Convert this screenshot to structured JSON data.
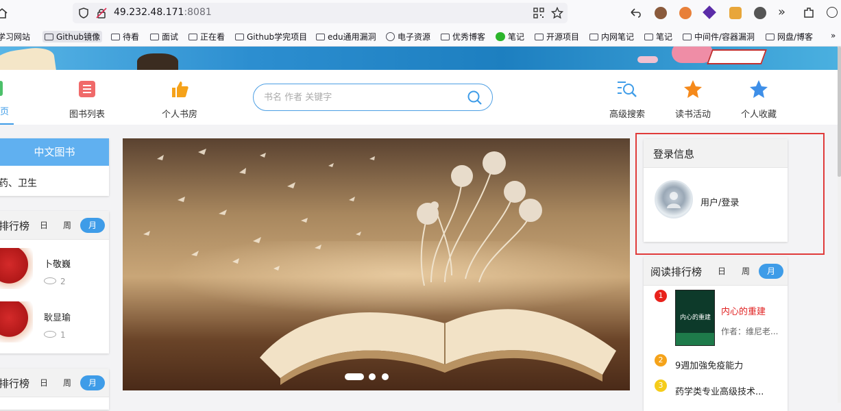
{
  "browser": {
    "url_host": "49.232.48.171",
    "url_port": ":8081",
    "bookmarks": [
      "学习网站",
      "Github镜像",
      "待看",
      "面试",
      "正在看",
      "Github学完项目",
      "edu通用漏洞",
      "电子资源",
      "优秀博客",
      "笔记",
      "开源项目",
      "内网笔记",
      "笔记",
      "中间件/容器漏洞",
      "网盘/博客"
    ]
  },
  "nav": {
    "home": "首页",
    "book_list": "图书列表",
    "my_shelf": "个人书房",
    "search_placeholder": "书名 作者 关键字",
    "advanced_search": "高级搜索",
    "reading_events": "读书活动",
    "favorites": "个人收藏"
  },
  "left": {
    "category_header": "中文图书",
    "category_item": "药、卫生",
    "rank1_title": "排行榜",
    "rank2_title": "排行榜",
    "tabs": [
      "日",
      "周",
      "月"
    ],
    "users": [
      {
        "name": "卜敬巍",
        "views": "2"
      },
      {
        "name": "耿显瑜",
        "views": "1"
      }
    ]
  },
  "carousel": {
    "slides": 3,
    "active": 1
  },
  "login": {
    "title": "登录信息",
    "link": "用户/登录"
  },
  "reading_rank": {
    "title": "阅读排行榜",
    "tabs": [
      "日",
      "周",
      "月"
    ],
    "items": [
      {
        "rank": "1",
        "title": "内心的重建",
        "author": "作者：维尼老...",
        "cover_text": "内心的重建"
      },
      {
        "rank": "2",
        "title": "9週加強免疫能力"
      },
      {
        "rank": "3",
        "title": "药学类专业高级技术..."
      }
    ]
  },
  "colors": {
    "accent": "#3e9ce8",
    "highlight_border": "#e03a3a",
    "rank1": "#e8221b",
    "rank2": "#f5a31a",
    "rank3": "#f5cc1a"
  }
}
